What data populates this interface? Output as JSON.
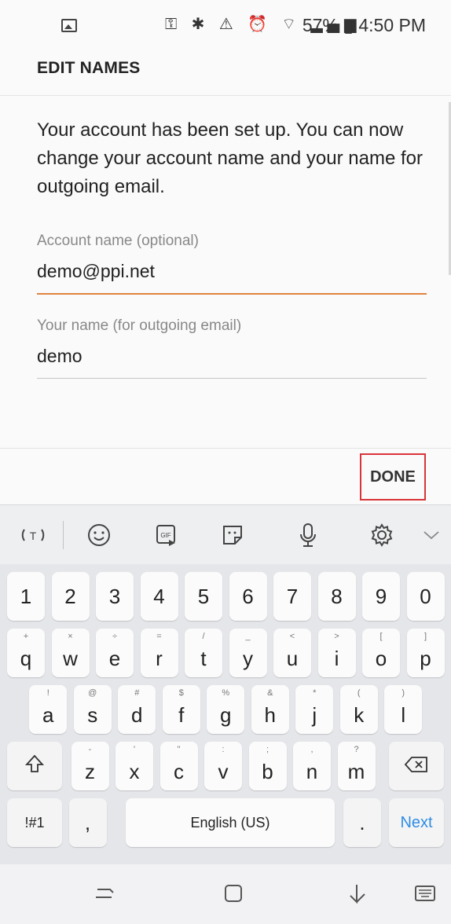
{
  "status_bar": {
    "icons": "⚿ ✱ ⚠ ⏰ ⌔ ▂▄▆",
    "battery": "57%",
    "time": "4:50 PM",
    "right_text": "57% ▮ 4:50 PM"
  },
  "header": {
    "title": "EDIT NAMES"
  },
  "content": {
    "message": "Your account has been set up. You can now change your account name and your name for outgoing email.",
    "account_name_label": "Account name (optional)",
    "account_name_value": "demo@ppi.net",
    "your_name_label": "Your name (for outgoing email)",
    "your_name_value": "demo"
  },
  "actions": {
    "done_label": "DONE"
  },
  "keyboard_toolbar": {
    "icons": [
      "text-recognition-icon",
      "emoji-icon",
      "gif-icon",
      "sticker-icon",
      "mic-icon",
      "settings-icon",
      "collapse-icon"
    ]
  },
  "keyboard": {
    "number_row": [
      "1",
      "2",
      "3",
      "4",
      "5",
      "6",
      "7",
      "8",
      "9",
      "0"
    ],
    "row1": [
      {
        "key": "q",
        "hint": "+"
      },
      {
        "key": "w",
        "hint": "×"
      },
      {
        "key": "e",
        "hint": "÷"
      },
      {
        "key": "r",
        "hint": "="
      },
      {
        "key": "t",
        "hint": "/"
      },
      {
        "key": "y",
        "hint": "_"
      },
      {
        "key": "u",
        "hint": "<"
      },
      {
        "key": "i",
        "hint": ">"
      },
      {
        "key": "o",
        "hint": "["
      },
      {
        "key": "p",
        "hint": "]"
      }
    ],
    "row2": [
      {
        "key": "a",
        "hint": "!"
      },
      {
        "key": "s",
        "hint": "@"
      },
      {
        "key": "d",
        "hint": "#"
      },
      {
        "key": "f",
        "hint": "$"
      },
      {
        "key": "g",
        "hint": "%"
      },
      {
        "key": "h",
        "hint": "&"
      },
      {
        "key": "j",
        "hint": "*"
      },
      {
        "key": "k",
        "hint": "("
      },
      {
        "key": "l",
        "hint": ")"
      }
    ],
    "row3": [
      {
        "key": "z",
        "hint": "-"
      },
      {
        "key": "x",
        "hint": "'"
      },
      {
        "key": "c",
        "hint": "\""
      },
      {
        "key": "v",
        "hint": ":"
      },
      {
        "key": "b",
        "hint": ";"
      },
      {
        "key": "n",
        "hint": ","
      },
      {
        "key": "m",
        "hint": "?"
      }
    ],
    "symbols_label": "!#1",
    "comma_label": ",",
    "space_label": "English (US)",
    "period_label": ".",
    "next_label": "Next"
  },
  "nav_bar": {
    "icons": [
      "recents-icon",
      "home-icon",
      "back-icon",
      "keyboard-switch-icon"
    ]
  },
  "colors": {
    "accent_underline": "#e0823e",
    "done_highlight": "#d9343a",
    "next_key": "#2f8de4"
  }
}
